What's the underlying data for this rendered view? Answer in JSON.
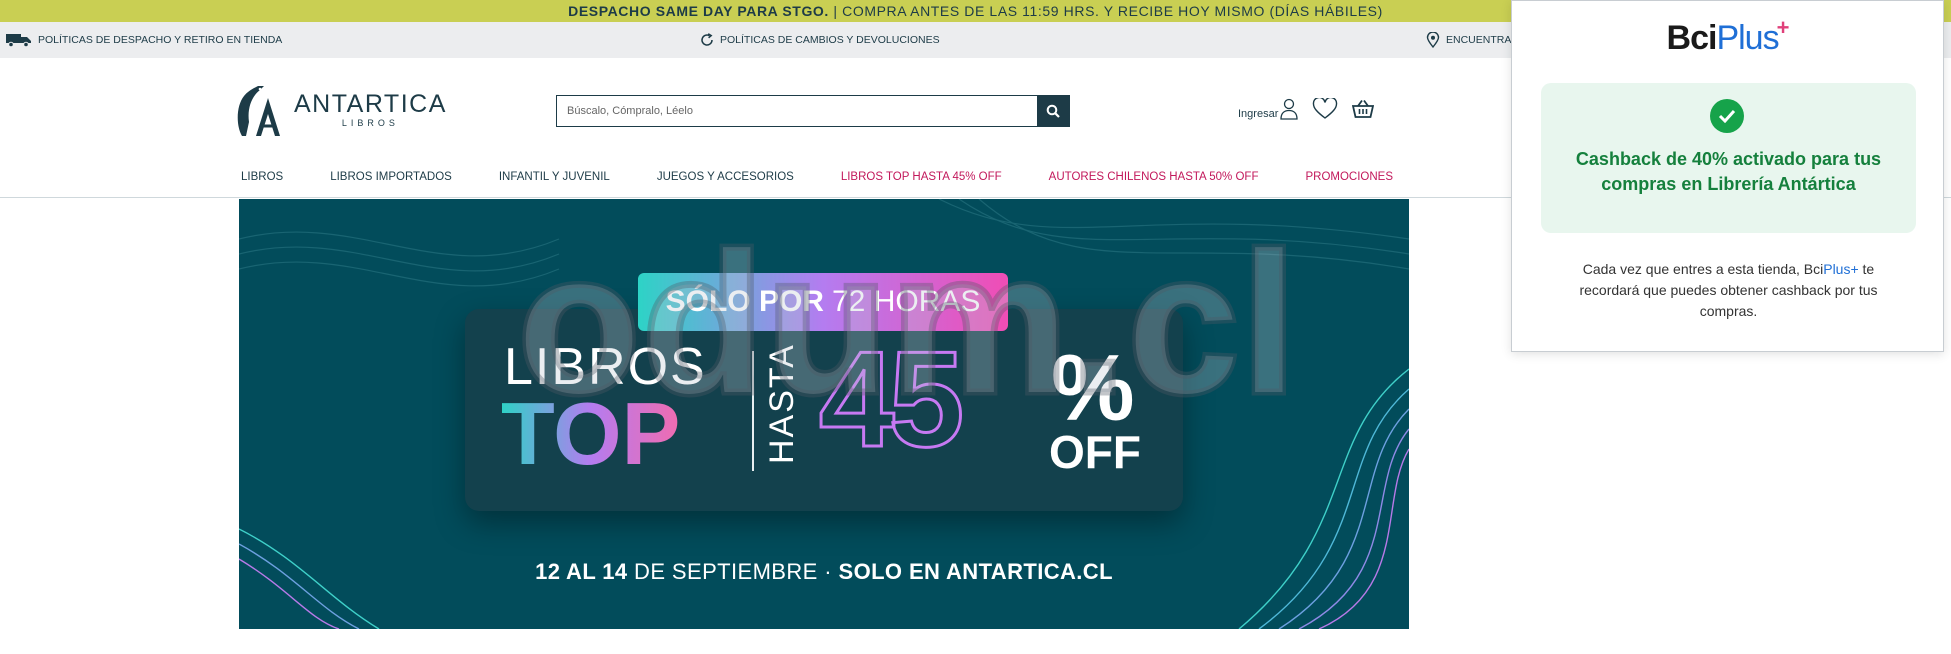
{
  "promo_bar": {
    "bold": "DESPACHO SAME DAY PARA STGO.",
    "rest": " | COMPRA ANTES DE LAS 11:59 HRS. Y RECIBE HOY MISMO (DÍAS HÁBILES)"
  },
  "info_bar": {
    "items": [
      {
        "label": "POLÍTICAS DE DESPACHO Y RETIRO EN TIENDA",
        "icon": "truck-icon"
      },
      {
        "label": "POLÍTICAS DE CAMBIOS Y DEVOLUCIONES",
        "icon": "refresh-icon"
      },
      {
        "label": "ENCUENTRA",
        "icon": "location-pin-icon"
      }
    ]
  },
  "header": {
    "logo_name": "ANTARTICA",
    "logo_sub": "LIBROS",
    "search_placeholder": "Búscalo, Cómpralo, Léelo",
    "login_label": "Ingresar"
  },
  "nav": {
    "items": [
      {
        "label": "LIBROS",
        "highlight": false
      },
      {
        "label": "LIBROS IMPORTADOS",
        "highlight": false
      },
      {
        "label": "INFANTIL Y JUVENIL",
        "highlight": false
      },
      {
        "label": "JUEGOS Y ACCESORIOS",
        "highlight": false
      },
      {
        "label": "LIBROS TOP HASTA 45% OFF",
        "highlight": true
      },
      {
        "label": "AUTORES CHILENOS HASTA 50% OFF",
        "highlight": true
      },
      {
        "label": "PROMOCIONES",
        "highlight": true
      }
    ],
    "highlight_color": "#c2185b"
  },
  "banner": {
    "pill_bold": "SÓLO POR",
    "pill_rest": "72 HORAS",
    "libros": "LIBROS",
    "top": "TOP",
    "hasta": "HASTA",
    "number": "45",
    "percent": "%",
    "off": "OFF",
    "dates_bold_1": "12 AL 14",
    "dates_mid": " DE SEPTIEMBRE · ",
    "dates_bold_2": "SOLO EN ANTARTICA.CL",
    "background_color": "#024c5b"
  },
  "watermark": "odum.cl",
  "popup": {
    "logo_bci": "Bci",
    "logo_plus": "Plus",
    "logo_cross": "+",
    "cashback_pre": "Cashback de ",
    "cashback_pct": "40%",
    "cashback_mid": " activado para tus compras en Librería Antártica",
    "note_pre": "Cada vez que entres a esta tienda, Bci",
    "note_plus": "Plus+",
    "note_post": " te recordará que puedes obtener cashback por tus compras.",
    "accent_color": "#1f6fd6",
    "success_color": "#16a34a"
  }
}
